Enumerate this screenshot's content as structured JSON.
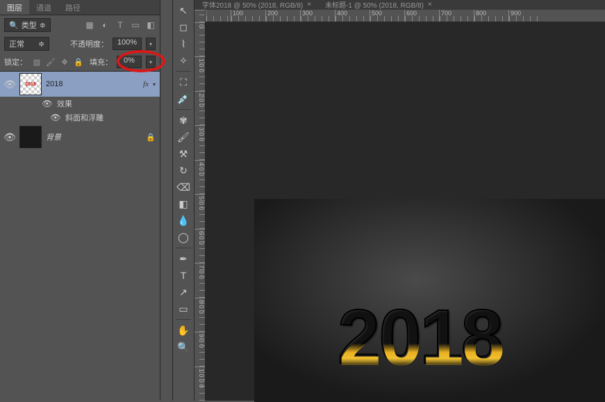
{
  "panel": {
    "tabs": {
      "layers": "图层",
      "channels": "通道",
      "paths": "路径"
    },
    "typeFilter": "类型",
    "blendMode": "正常",
    "opacityLabel": "不透明度：",
    "opacityValue": "100%",
    "lockLabel": "锁定：",
    "fillLabel": "填充：",
    "fillValue": "0%"
  },
  "layers": {
    "main": {
      "name": "2018",
      "thumbText": "2018",
      "fx": "fx"
    },
    "effectsLabel": "效果",
    "bevelLabel": "斜面和浮雕",
    "background": {
      "name": "背景"
    }
  },
  "docTabs": {
    "tab1": "字体2018 @ 50% (2018, RGB/8)",
    "tab2": "未标题-1 @ 50% (2018, RGB/8)"
  },
  "rulerH": [
    "100",
    "200",
    "300",
    "400",
    "500",
    "600",
    "700",
    "800",
    "900"
  ],
  "rulerV": [
    "0",
    "1 0 0",
    "2 0 0",
    "3 0 0",
    "4 0 0",
    "5 0 0",
    "6 0 0",
    "7 0 0",
    "8 0 0",
    "9 0 0",
    "1 0 0 0"
  ],
  "canvasText": "2018"
}
